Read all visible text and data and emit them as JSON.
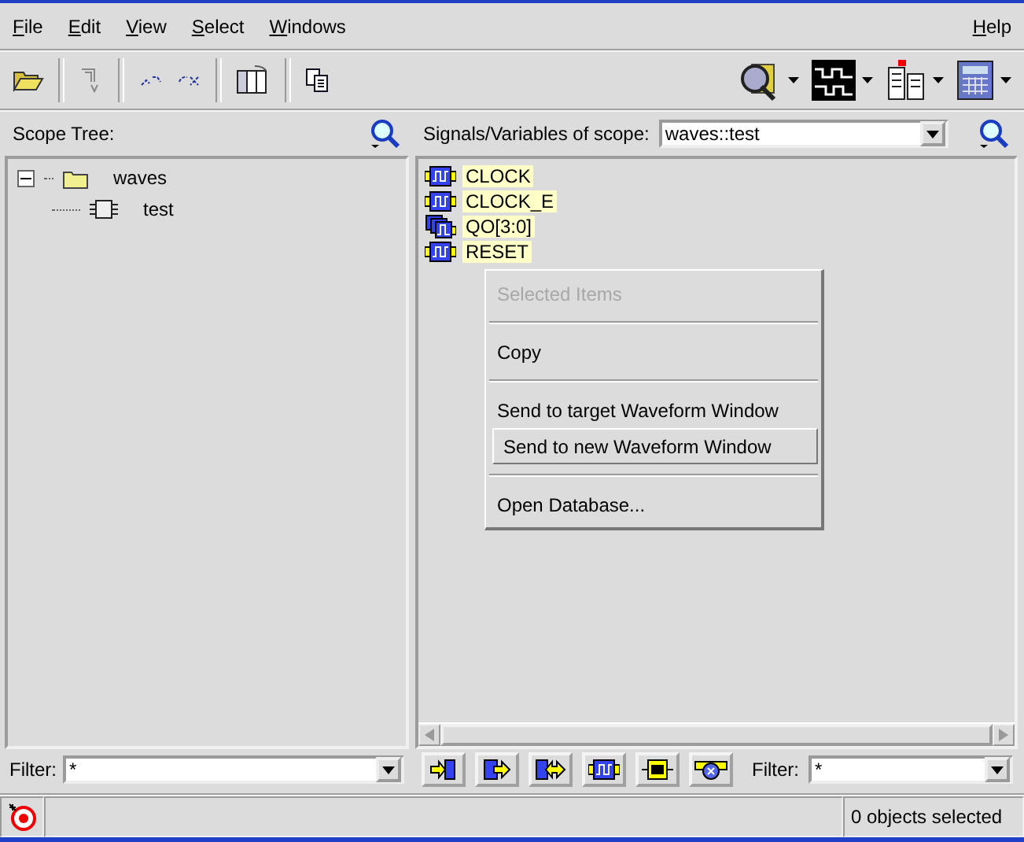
{
  "menus": [
    "File",
    "Edit",
    "View",
    "Select",
    "Windows"
  ],
  "help_menu": "Help",
  "scope_tree": {
    "title": "Scope Tree:",
    "items": [
      {
        "label": "waves",
        "expanded": true,
        "children": [
          {
            "label": "test"
          }
        ]
      }
    ],
    "filter": {
      "label": "Filter:",
      "value": "*"
    }
  },
  "signals": {
    "title": "Signals/Variables of scope:",
    "scope": "waves::test",
    "items": [
      {
        "label": "CLOCK",
        "kind": "bit",
        "selected": true
      },
      {
        "label": "CLOCK_E",
        "kind": "bit",
        "selected": true
      },
      {
        "label": "QO[3:0]",
        "kind": "bus",
        "selected": true
      },
      {
        "label": "RESET",
        "kind": "bit",
        "selected": true
      }
    ],
    "filter": {
      "label": "Filter:",
      "value": "*"
    }
  },
  "context_menu": {
    "items": [
      {
        "kind": "header",
        "label": "Selected Items",
        "disabled": true
      },
      {
        "kind": "separator"
      },
      {
        "kind": "item",
        "label": "Copy",
        "selected": false
      },
      {
        "kind": "separator"
      },
      {
        "kind": "item",
        "label": "Send to target Waveform Window",
        "selected": false
      },
      {
        "kind": "item",
        "label": "Send to new Waveform Window",
        "selected": true
      },
      {
        "kind": "separator"
      },
      {
        "kind": "item",
        "label": "Open Database...",
        "selected": false
      }
    ]
  },
  "status_bar": {
    "message": "0 objects selected"
  }
}
